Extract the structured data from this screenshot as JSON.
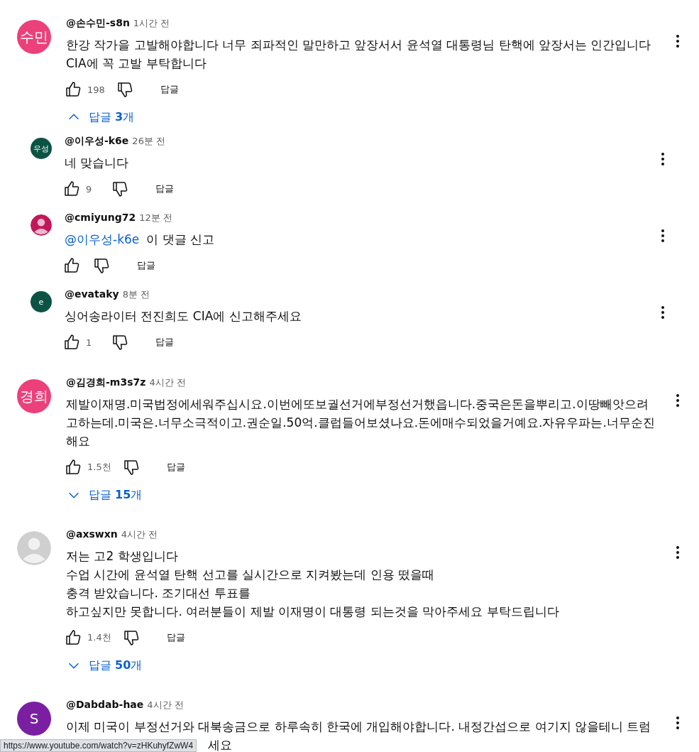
{
  "comments": [
    {
      "author": "@손수민-s8n",
      "time": "1시간 전",
      "avatar": {
        "kind": "initials",
        "text": "수민",
        "color": "#ec407a"
      },
      "body": [
        {
          "kind": "text",
          "text": "한강 작가을  고발해야합니다  너무 죄파적인  말만하고  앞장서서  윤석열 대통령님  탄핵에  앞장서는 인간입니다  CIA에 꼭 고발  부탁합니다"
        }
      ],
      "likes": "198",
      "reply_label": "답글",
      "replies": {
        "expanded": true,
        "label": "답글 **3**개",
        "items": [
          {
            "author": "@이우성-k6e",
            "time": "26분 전",
            "avatar": {
              "kind": "initials",
              "text": "우성",
              "color": "#0b5345"
            },
            "body": [
              {
                "kind": "text",
                "text": "네 맞습니다"
              }
            ],
            "likes": "9",
            "reply_label": "답글"
          },
          {
            "author": "@cmiyung72",
            "time": "12분 전",
            "avatar": {
              "kind": "silhouette",
              "color": "#c2185b"
            },
            "body": [
              {
                "kind": "mention",
                "text": "@이우성-k6e"
              },
              {
                "kind": "text",
                "text": "이 댓글 신고"
              }
            ],
            "reply_label": "답글"
          },
          {
            "author": "@evataky",
            "time": "8분 전",
            "avatar": {
              "kind": "initials",
              "text": "e",
              "color": "#0b5345"
            },
            "body": [
              {
                "kind": "text",
                "text": "싱어송라이터 전진희도  CIA에 신고해주세요"
              }
            ],
            "likes": "1",
            "reply_label": "답글"
          }
        ]
      }
    },
    {
      "author": "@김경희-m3s7z",
      "time": "4시간 전",
      "avatar": {
        "kind": "initials",
        "text": "경희",
        "color": "#ec407a"
      },
      "body": [
        {
          "kind": "text",
          "text": "제발이재명.미국법정에세워주십시요.이번에또보궐선거에부정선거했읍니다.중국은돈을뿌리고.이땅빼앗으려고하는데.미국은.너무소극적이고.권순일.50억.클럽들어보셨나요.돈에매수되었을거예요.자유우파는.너무순진해요"
        }
      ],
      "likes": "1.5천",
      "reply_label": "답글",
      "replies": {
        "expanded": false,
        "label": "답글 **15**개"
      }
    },
    {
      "author": "@axswxn",
      "time": "4시간 전",
      "avatar": {
        "kind": "silhouette",
        "color": "#cfcfcf"
      },
      "body": [
        {
          "kind": "text",
          "text": "저는 고2 학생입니다\n수업 시간에  윤석열 탄핵 선고를 실시간으로 지켜봤는데 인용 떴을때\n충격 받았습니다. 조기대선 투표를\n하고싶지만 못합니다. 여러분들이 제발 이재명이 대통령 되는것을 막아주세요 부탁드립니다"
        }
      ],
      "likes": "1.4천",
      "reply_label": "답글",
      "replies": {
        "expanded": false,
        "label": "답글 **50**개"
      }
    },
    {
      "author": "@Dabdab-hae",
      "time": "4시간 전",
      "avatar": {
        "kind": "initials",
        "text": "S",
        "color": "#7b1fa2"
      },
      "body": [
        {
          "kind": "text",
          "text": "이제 미국이 부정선거와 대북송금으로 하루속히 한국에 개입해야합니다. 내정간섭으로 여기지 않을테니 트럼"
        }
      ],
      "covered_tail": "세요"
    }
  ],
  "status_bar": {
    "url": "https://www.youtube.com/watch?v=zHKuhyfZwW4"
  }
}
